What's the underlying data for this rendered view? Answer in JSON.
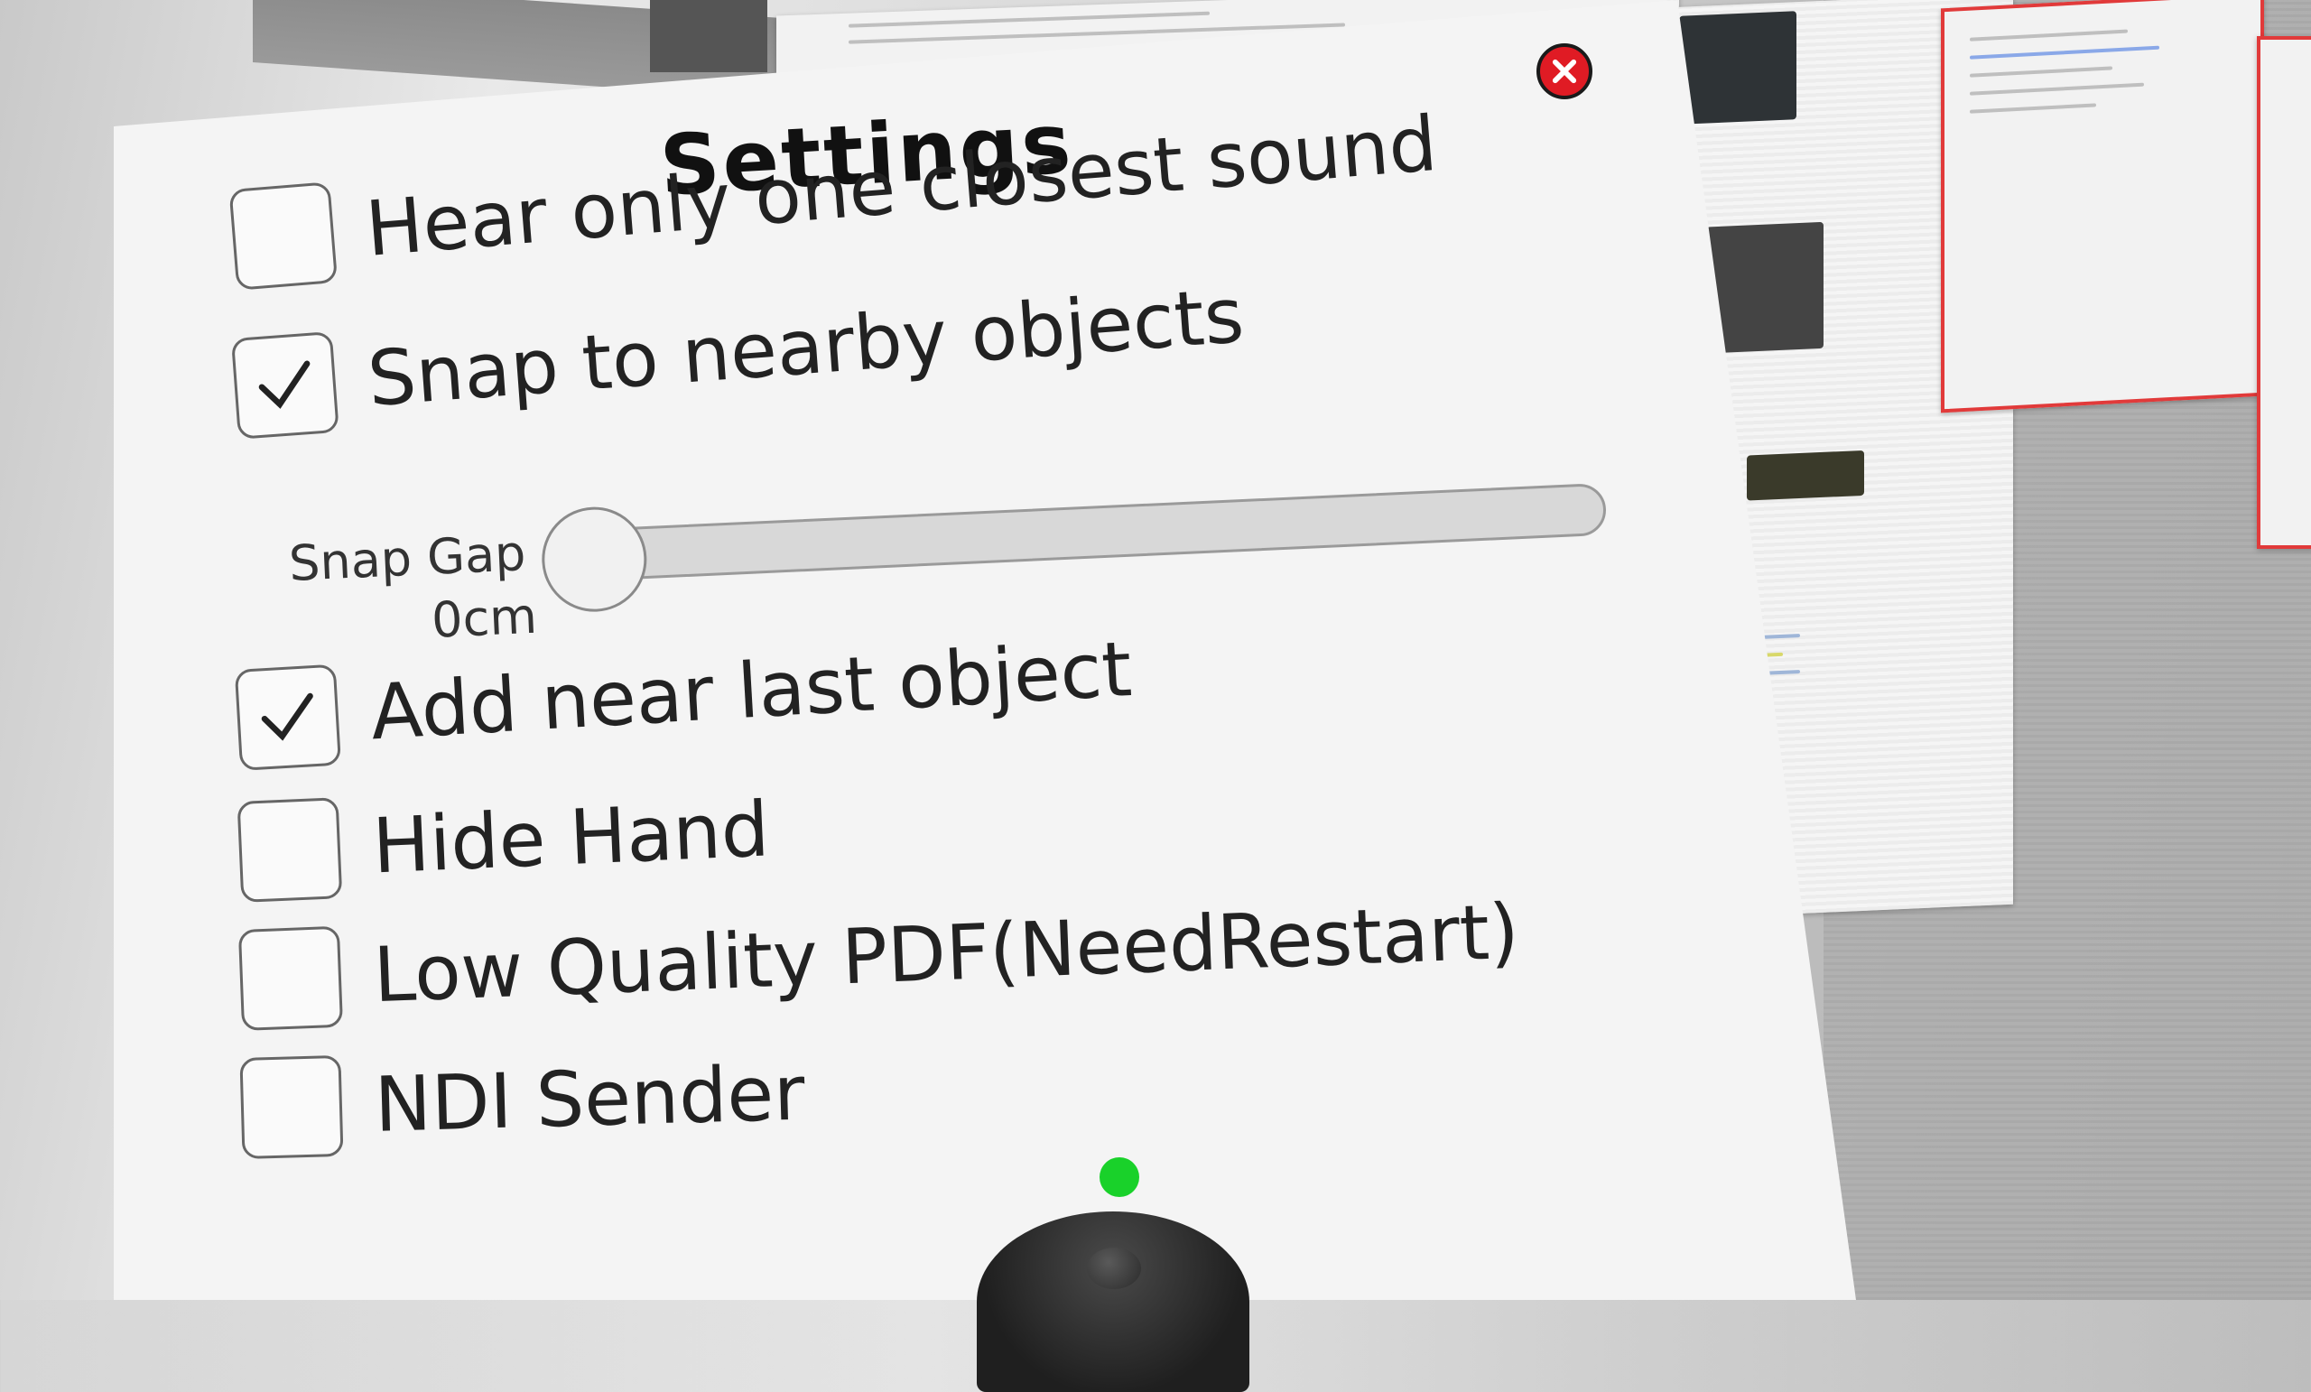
{
  "panel": {
    "title": "Settings",
    "close_icon": "close-icon",
    "options": [
      {
        "label": "Hear only one closest sound",
        "checked": false
      },
      {
        "label": "Snap to nearby objects",
        "checked": true
      },
      {
        "label": "Add near last object",
        "checked": true
      },
      {
        "label": "Hide Hand",
        "checked": false
      },
      {
        "label": "Low Quality PDF(NeedRestart)",
        "checked": false
      },
      {
        "label": "NDI Sender",
        "checked": false
      }
    ],
    "snap_gap": {
      "label": "Snap Gap",
      "value_text": "0cm",
      "value_fraction": 0
    }
  },
  "colors": {
    "close_button": "#e01b24",
    "pointer": "#19d12a",
    "panel": "#f4f4f4"
  }
}
